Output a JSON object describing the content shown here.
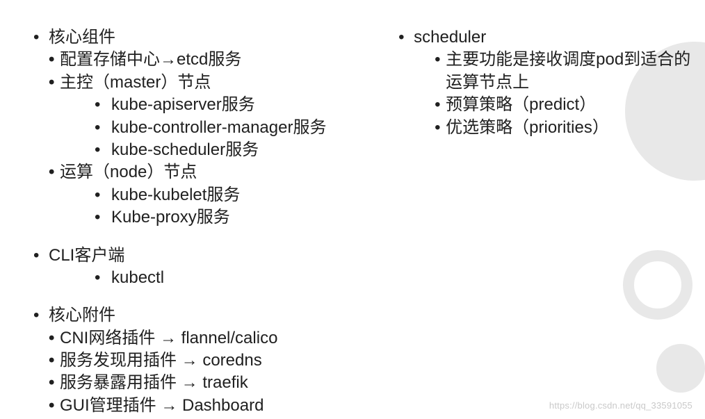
{
  "left": {
    "section1": {
      "title": "核心组件",
      "items": [
        "配置存储中心→etcd服务",
        "主控（master）节点"
      ],
      "master_children": [
        "kube-apiserver服务",
        "kube-controller-manager服务",
        "kube-scheduler服务"
      ],
      "node_label": "运算（node）节点",
      "node_children": [
        "kube-kubelet服务",
        "Kube-proxy服务"
      ]
    },
    "section2": {
      "title": "CLI客户端",
      "children": [
        "kubectl"
      ]
    },
    "section3": {
      "title": "核心附件",
      "items": [
        "CNI网络插件 → flannel/calico",
        "服务发现用插件 → coredns",
        "服务暴露用插件 → traefik",
        "GUI管理插件 → Dashboard"
      ]
    }
  },
  "right": {
    "title": "scheduler",
    "items": [
      "主要功能是接收调度pod到适合的运算节点上",
      "预算策略（predict）",
      "优选策略（priorities）"
    ]
  },
  "watermark": "https://blog.csdn.net/qq_33591055"
}
